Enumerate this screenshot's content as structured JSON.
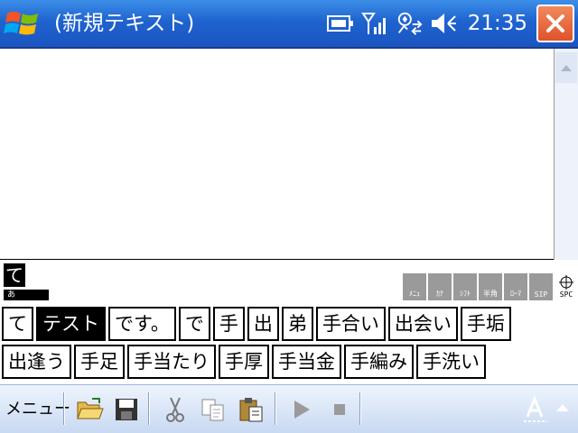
{
  "window": {
    "title": "(新規テキスト)",
    "clock": "21:35",
    "status_icons": [
      "battery-icon",
      "signal-icon",
      "connectivity-icon",
      "volume-muted-icon"
    ]
  },
  "ime": {
    "composing": "て",
    "composing_sub": "あ",
    "tools": [
      "ﾒﾆｭ",
      "ｶﾅ",
      "ｼﾌﾄ",
      "半角",
      "ﾛｰﾏ",
      "SIP",
      "SPC"
    ],
    "candidates_row1": [
      "て",
      "テスト",
      "です。",
      "で",
      "手",
      "出",
      "弟",
      "手合い",
      "出会い",
      "手垢"
    ],
    "candidates_row2": [
      "出逢う",
      "手足",
      "手当たり",
      "手厚",
      "手当金",
      "手編み",
      "手洗い"
    ],
    "selected_candidate": "テスト"
  },
  "menubar": {
    "menu_label": "メニュー",
    "toolbar": [
      "open-folder-icon",
      "save-icon",
      "cut-icon",
      "copy-icon",
      "paste-icon",
      "play-icon",
      "stop-icon",
      "input-method-icon"
    ]
  },
  "colors": {
    "titlebar": "#1f63cf",
    "close": "#e0522a",
    "menubar": "#c8d9f2"
  }
}
